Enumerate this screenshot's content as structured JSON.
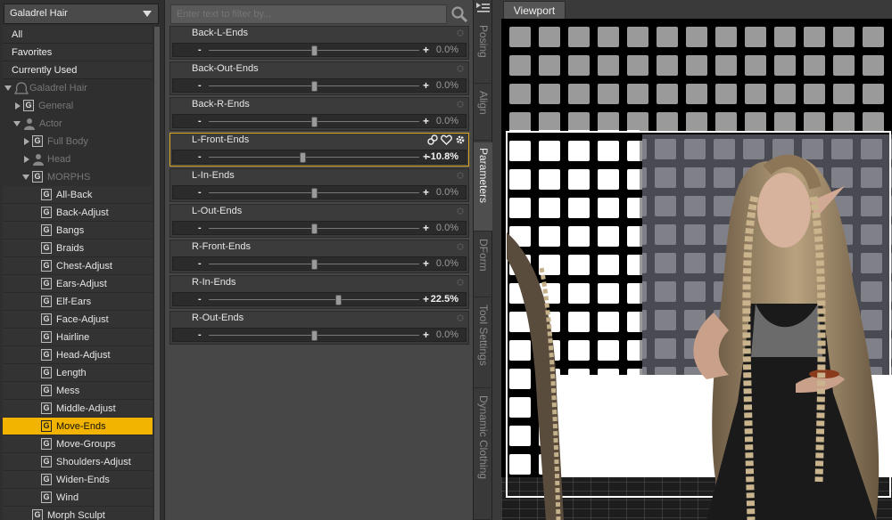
{
  "left_panel": {
    "node_selector": "Galadrel Hair",
    "filters": [
      "All",
      "Favorites",
      "Currently Used"
    ],
    "tree": {
      "root": "Galadrel Hair",
      "general": "General",
      "actor": "Actor",
      "full_body": "Full Body",
      "head": "Head",
      "morphs": "MORPHS",
      "morph_items": [
        "All-Back",
        "Back-Adjust",
        "Bangs",
        "Braids",
        "Chest-Adjust",
        "Ears-Adjust",
        "Elf-Ears",
        "Face-Adjust",
        "Hairline",
        "Head-Adjust",
        "Length",
        "Mess",
        "Middle-Adjust",
        "Move-Ends",
        "Move-Groups",
        "Shoulders-Adjust",
        "Widen-Ends",
        "Wind"
      ],
      "selected": "Move-Ends",
      "morph_sculpt": "Morph Sculpt"
    }
  },
  "middle_panel": {
    "filter_placeholder": "Enter text to filter by...",
    "params": [
      {
        "name": "Back-L-Ends",
        "value": "0.0%",
        "fraction": 0.5
      },
      {
        "name": "Back-Out-Ends",
        "value": "0.0%",
        "fraction": 0.5
      },
      {
        "name": "Back-R-Ends",
        "value": "0.0%",
        "fraction": 0.5
      },
      {
        "name": "L-Front-Ends",
        "value": "-10.8%",
        "fraction": 0.446
      },
      {
        "name": "L-In-Ends",
        "value": "0.0%",
        "fraction": 0.5
      },
      {
        "name": "L-Out-Ends",
        "value": "0.0%",
        "fraction": 0.5
      },
      {
        "name": "R-Front-Ends",
        "value": "0.0%",
        "fraction": 0.5
      },
      {
        "name": "R-In-Ends",
        "value": "22.5%",
        "fraction": 0.6125
      },
      {
        "name": "R-Out-Ends",
        "value": "0.0%",
        "fraction": 0.5
      }
    ],
    "selected_param": "L-Front-Ends",
    "slider_minus": "-",
    "slider_plus": "+"
  },
  "side_tabs": [
    "Posing",
    "Align",
    "Parameters",
    "DForm",
    "Tool Settings",
    "Dynamic Clothing"
  ],
  "active_side_tab": "Parameters",
  "viewport": {
    "tab_label": "Viewport"
  },
  "colors": {
    "accent": "#f2b400",
    "selected_border": "#d8a91e"
  }
}
